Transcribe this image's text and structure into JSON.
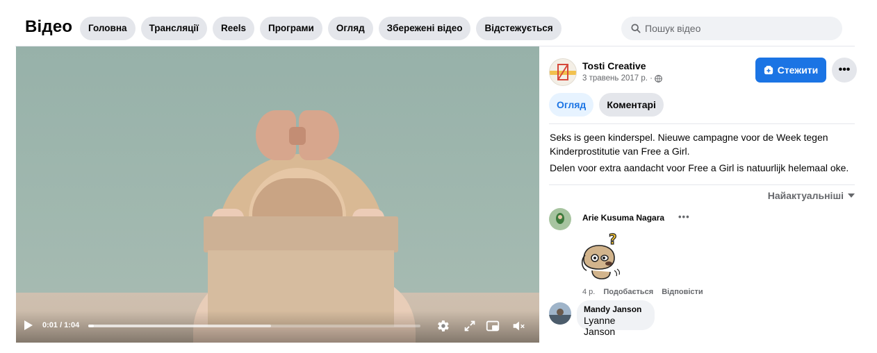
{
  "header": {
    "title": "Відео",
    "tabs": [
      "Головна",
      "Трансляції",
      "Reels",
      "Програми",
      "Огляд",
      "Збережені відео",
      "Відстежується"
    ],
    "search_placeholder": "Пошук відео"
  },
  "video": {
    "time": "0:01 / 1:04",
    "progress_fraction": 0.016,
    "buffered_fraction": 0.55,
    "controls": [
      "play-icon",
      "settings-icon",
      "fullscreen-icon",
      "picture-in-picture-icon",
      "volume-muted-icon"
    ]
  },
  "post": {
    "author": "Tosti Creative",
    "date": "3 травень 2017 р. ·",
    "follow_label": "Стежити",
    "more_label": "•••",
    "tabs": {
      "overview": "Огляд",
      "comments": "Коментарі"
    },
    "description_1": "Seks is geen kinderspel. Nieuwe campagne voor de Week tegen Kinderprostitutie van Free a Girl.",
    "description_2": "Delen voor extra aandacht voor Free a Girl is natuurlijk helemaal oke.",
    "sort_label": "Найактуальніші"
  },
  "comments": [
    {
      "name": "Arie Kusuma Nagara",
      "more": "•••",
      "age": "4 р.",
      "like": "Подобається",
      "reply": "Відповісти"
    },
    {
      "name": "Mandy Janson",
      "text": "Lyanne Janson"
    }
  ],
  "colors": {
    "accent": "#1b74e4",
    "tab_bg": "#e4e6eb",
    "muted_text": "#65676b"
  }
}
